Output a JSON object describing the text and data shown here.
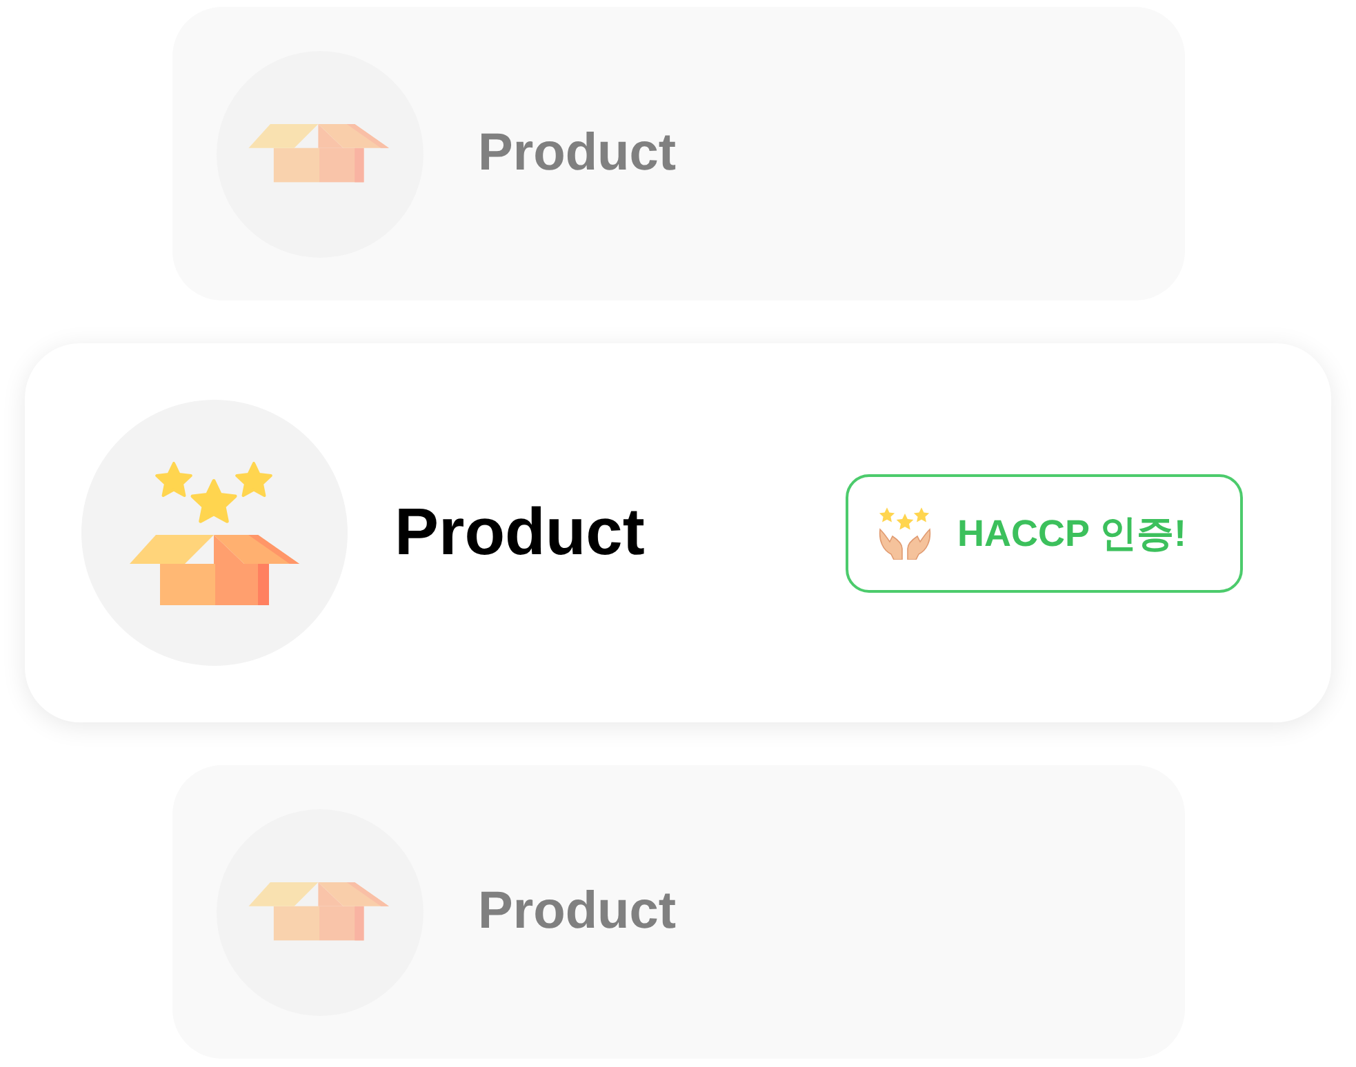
{
  "items": [
    {
      "label": "Product",
      "selected": false
    },
    {
      "label": "Product",
      "selected": true,
      "badge": "HACCP 인증!"
    },
    {
      "label": "Product",
      "selected": false
    }
  ]
}
